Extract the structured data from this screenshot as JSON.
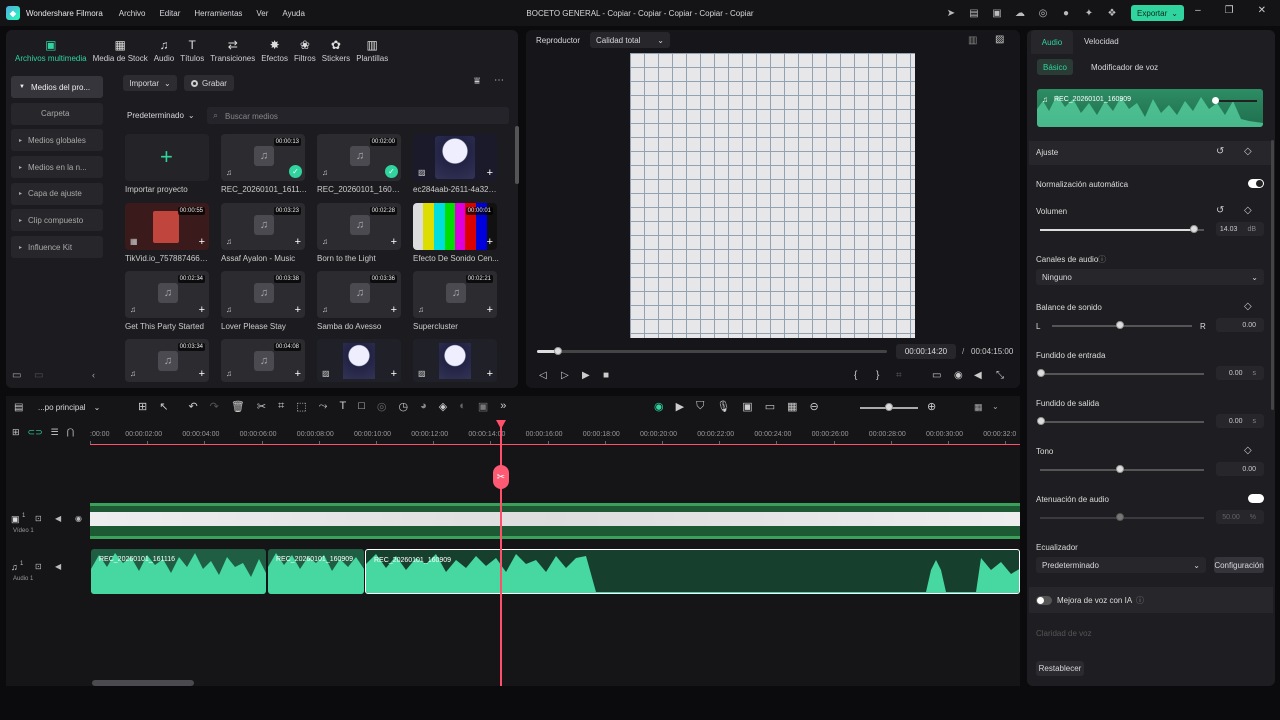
{
  "app": {
    "name": "Wondershare Filmora",
    "doc_title": "BOCETO GENERAL - Copiar - Copiar - Copiar - Copiar - Copiar"
  },
  "menu": [
    "Archivo",
    "Editar",
    "Herramientas",
    "Ver",
    "Ayuda"
  ],
  "export_label": "Exportar",
  "media_tabs": [
    {
      "label": "Archivos multimedia",
      "icon": "media-icon"
    },
    {
      "label": "Media de Stock",
      "icon": "stock-icon"
    },
    {
      "label": "Audio",
      "icon": "audio-icon"
    },
    {
      "label": "Títulos",
      "icon": "titles-icon"
    },
    {
      "label": "Transiciones",
      "icon": "transitions-icon"
    },
    {
      "label": "Efectos",
      "icon": "effects-icon"
    },
    {
      "label": "Filtros",
      "icon": "filters-icon"
    },
    {
      "label": "Stickers",
      "icon": "stickers-icon"
    },
    {
      "label": "Plantillas",
      "icon": "templates-icon"
    }
  ],
  "sidebar": [
    {
      "label": "Medios del pro..."
    },
    {
      "label": "Carpeta"
    },
    {
      "label": "Medios globales"
    },
    {
      "label": "Medios en la n..."
    },
    {
      "label": "Capa de ajuste"
    },
    {
      "label": "Clip compuesto"
    },
    {
      "label": "Influence Kit"
    }
  ],
  "media_toolbar": {
    "import": "Importar",
    "record": "Grabar",
    "sort": "Predeterminado",
    "search_placeholder": "Buscar medios"
  },
  "media_items": [
    {
      "label": "Importar proyecto",
      "duration": ""
    },
    {
      "label": "REC_20260101_161116",
      "duration": "00:00:13"
    },
    {
      "label": "REC_20260101_160909",
      "duration": "00:02:00"
    },
    {
      "label": "ec284aab-2611-4a32-8...",
      "duration": ""
    },
    {
      "label": "TikVid.io_75788746640...",
      "duration": "00:00:55"
    },
    {
      "label": "Assaf Ayalon - Music",
      "duration": "00:03:23"
    },
    {
      "label": "Born to the Light",
      "duration": "00:02:28"
    },
    {
      "label": "Efecto De Sonido  Cen...",
      "duration": "00:00:01"
    },
    {
      "label": "Get This Party Started",
      "duration": "00:02:34"
    },
    {
      "label": "Lover Please Stay",
      "duration": "00:03:38"
    },
    {
      "label": "Samba do Avesso",
      "duration": "00:03:36"
    },
    {
      "label": "Supercluster",
      "duration": "00:02:21"
    },
    {
      "label": "",
      "duration": "00:03:34"
    },
    {
      "label": "",
      "duration": "00:04:08"
    },
    {
      "label": "",
      "duration": ""
    },
    {
      "label": "",
      "duration": ""
    }
  ],
  "player": {
    "tab": "Reproductor",
    "quality": "Calidad total",
    "current": "00:00:14:20",
    "total": "00:04:15:00",
    "progress_fraction": 0.06
  },
  "right_panel": {
    "tabs": [
      "Audio",
      "Velocidad"
    ],
    "subtabs": [
      "Básico",
      "Modificador de voz"
    ],
    "clip_name": "REC_20260101_160909",
    "section": "Ajuste",
    "auto_norm": "Normalización automática",
    "volume_label": "Volumen",
    "volume_value": "14.03",
    "volume_unit": "dB",
    "channels_label": "Canales de audio",
    "channels_value": "Ninguno",
    "balance_label": "Balance de sonido",
    "balance_l": "L",
    "balance_r": "R",
    "balance_value": "0.00",
    "fadein_label": "Fundido de entrada",
    "fadein_value": "0.00",
    "fadein_unit": "s",
    "fadeout_label": "Fundido  de salida",
    "fadeout_value": "0.00",
    "fadeout_unit": "s",
    "pitch_label": "Tono",
    "pitch_value": "0.00",
    "ducking_label": "Atenuación de audio",
    "ducking_value": "50.00",
    "ducking_unit": "%",
    "eq_label": "Ecualizador",
    "eq_value": "Predeterminado",
    "eq_button": "Configuración",
    "voice_enh": "Mejora de voz con IA",
    "voice_clarity": "Claridad de voz",
    "reset": "Restablecer"
  },
  "timeline": {
    "sequence": "...po principal",
    "ticks": [
      ":00:00",
      "00:00:02:00",
      "00:00:04:00",
      "00:00:06:00",
      "00:00:08:00",
      "00:00:10:00",
      "00:00:12:00",
      "00:00:14:00",
      "00:00:16:00",
      "00:00:18:00",
      "00:00:20:00",
      "00:00:22:00",
      "00:00:24:00",
      "00:00:26:00",
      "00:00:28:00",
      "00:00:30:00",
      "00:00:32:0"
    ],
    "video_track": "Vídeo 1",
    "audio_track": "Audio 1",
    "video_badge": "1",
    "audio_badge": "1",
    "audio_clips": [
      "REC_20260101_161116",
      "REC_20260101_160909",
      "REC_20260101_160909"
    ]
  },
  "colors": {
    "accent": "#2fd49e",
    "playhead": "#ff4f6a",
    "audio_wave": "#46d8a0"
  }
}
